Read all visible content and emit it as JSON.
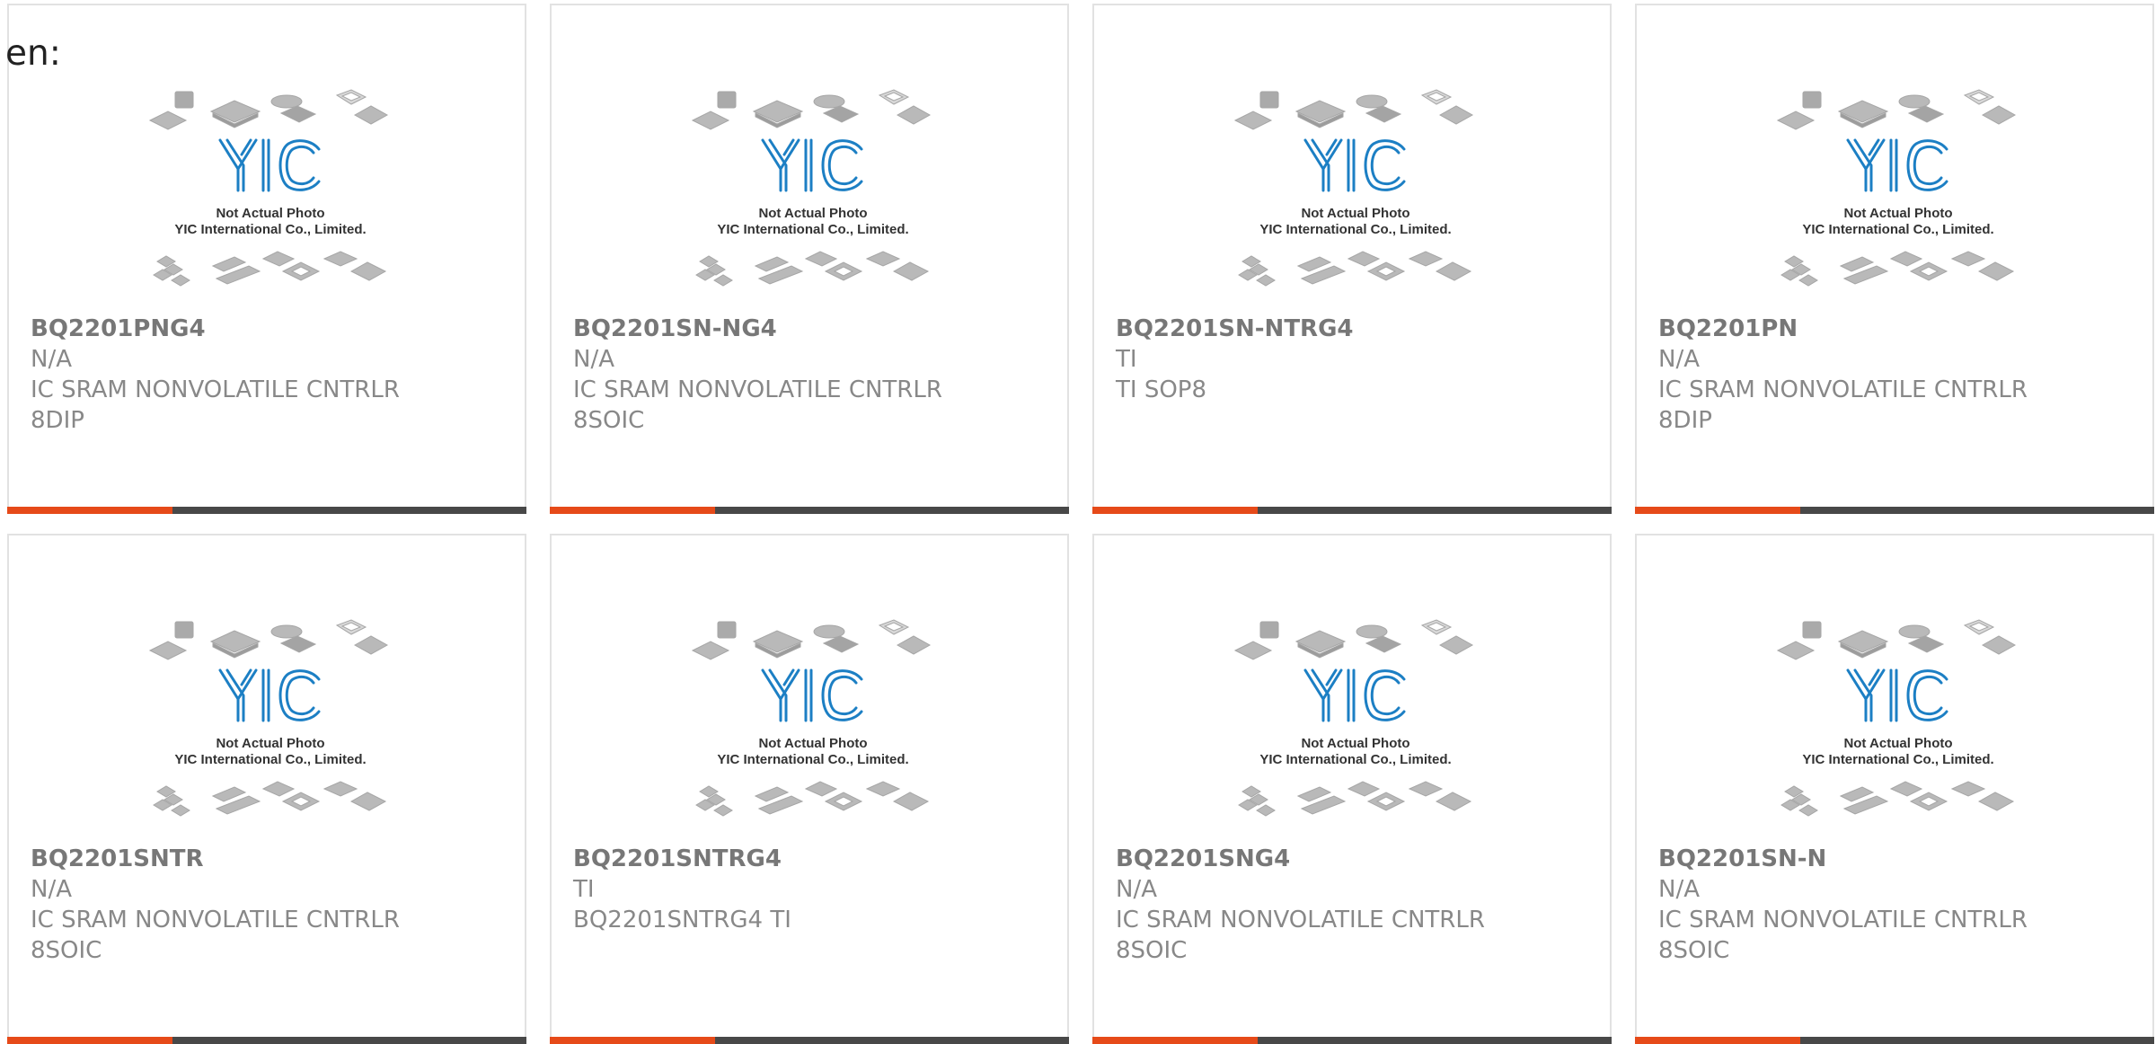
{
  "page": {
    "lang_label": "en:"
  },
  "image": {
    "caption_line1": "Not Actual Photo",
    "caption_line2": "YIC International Co., Limited.",
    "logo_text": "YIC"
  },
  "colors": {
    "accent": "#e64a19",
    "bar": "#484848",
    "logo_blue": "#1c7fc4",
    "text": "#888888",
    "border": "#e2e2e2"
  },
  "products": [
    {
      "part": "BQ2201PNG4",
      "mfr": "N/A",
      "desc": "IC SRAM NONVOLATILE CNTRLR",
      "package": "8DIP"
    },
    {
      "part": "BQ2201SN-NG4",
      "mfr": "N/A",
      "desc": "IC SRAM NONVOLATILE CNTRLR",
      "package": "8SOIC"
    },
    {
      "part": "BQ2201SN-NTRG4",
      "mfr": "TI",
      "desc": "TI SOP8",
      "package": ""
    },
    {
      "part": "BQ2201PN",
      "mfr": "N/A",
      "desc": "IC SRAM NONVOLATILE CNTRLR",
      "package": "8DIP"
    },
    {
      "part": "BQ2201SNTR",
      "mfr": "N/A",
      "desc": "IC SRAM NONVOLATILE CNTRLR",
      "package": "8SOIC"
    },
    {
      "part": "BQ2201SNTRG4",
      "mfr": "TI",
      "desc": "BQ2201SNTRG4 TI",
      "package": ""
    },
    {
      "part": "BQ2201SNG4",
      "mfr": "N/A",
      "desc": "IC SRAM NONVOLATILE CNTRLR",
      "package": "8SOIC"
    },
    {
      "part": "BQ2201SN-N",
      "mfr": "N/A",
      "desc": "IC SRAM NONVOLATILE CNTRLR",
      "package": "8SOIC"
    }
  ]
}
